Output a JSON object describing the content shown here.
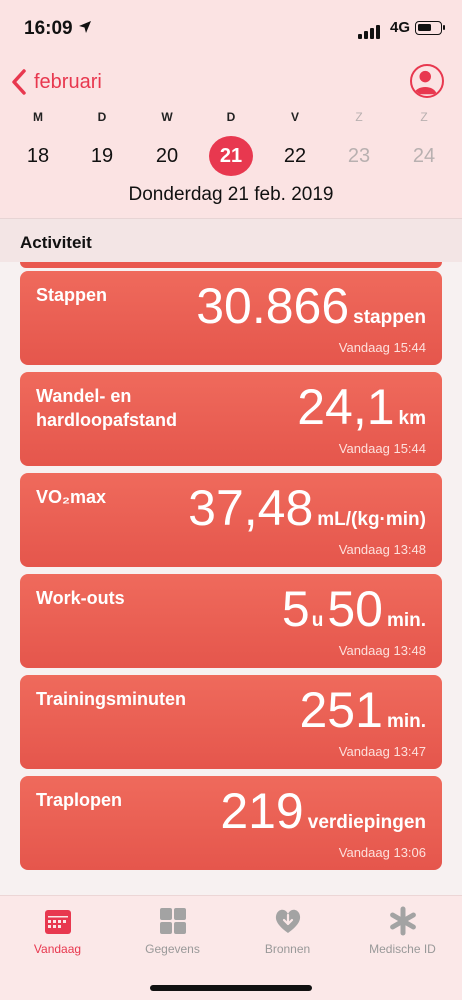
{
  "status": {
    "time": "16:09",
    "network": "4G"
  },
  "nav": {
    "back_label": "februari"
  },
  "week": {
    "letters": [
      "M",
      "D",
      "W",
      "D",
      "V",
      "Z",
      "Z"
    ],
    "dates": [
      "18",
      "19",
      "20",
      "21",
      "22",
      "23",
      "24"
    ],
    "selected_index": 3
  },
  "full_date": "Donderdag 21 feb. 2019",
  "section_title": "Activiteit",
  "cards": [
    {
      "label": "Stappen",
      "value": "30.866",
      "unit": "stappen",
      "time": "Vandaag 15:44"
    },
    {
      "label": "Wandel- en hardloopafstand",
      "value": "24,1",
      "unit": "km",
      "time": "Vandaag 15:44"
    },
    {
      "label": "VO₂max",
      "value": "37,48",
      "unit": "mL/(kg·min)",
      "time": "Vandaag 13:48"
    },
    {
      "label": "Work-outs",
      "value_hours": "5",
      "hours_unit": "u",
      "value_minutes": "50",
      "unit": "min.",
      "time": "Vandaag 13:48"
    },
    {
      "label": "Trainingsminuten",
      "value": "251",
      "unit": "min.",
      "time": "Vandaag 13:47"
    },
    {
      "label": "Traplopen",
      "value": "219",
      "unit": "verdiepingen",
      "time": "Vandaag 13:06"
    }
  ],
  "tabs": [
    {
      "label": "Vandaag",
      "icon": "today-icon",
      "active": true
    },
    {
      "label": "Gegevens",
      "icon": "grid-icon",
      "active": false
    },
    {
      "label": "Bronnen",
      "icon": "heart-download-icon",
      "active": false
    },
    {
      "label": "Medische ID",
      "icon": "asterisk-icon",
      "active": false
    }
  ],
  "colors": {
    "accent": "#e8384f",
    "card": "#e9584f",
    "inactive": "#999999"
  }
}
